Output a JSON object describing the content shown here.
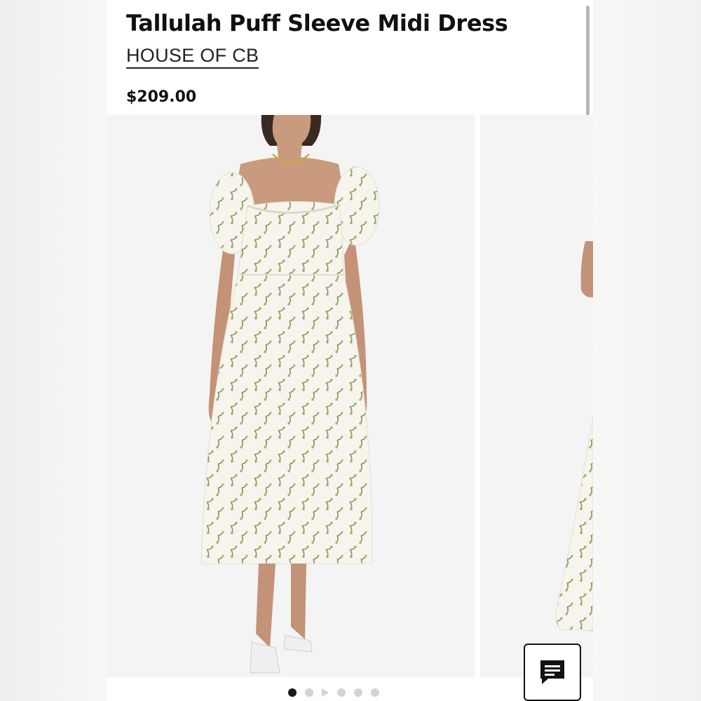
{
  "product": {
    "title": "Tallulah Puff Sleeve Midi Dress",
    "brand": "HOUSE OF CB",
    "price": "$209.00"
  },
  "gallery": {
    "slides": [
      {
        "icon": "model-wearing-floral-midi-dress-front-image"
      },
      {
        "icon": "model-wearing-floral-midi-dress-side-image"
      }
    ],
    "pagination": {
      "active_index": 0,
      "indicators": [
        "dot",
        "dot",
        "play",
        "dot",
        "dot",
        "dot"
      ]
    }
  },
  "chat": {
    "icon": "chat-message-icon"
  },
  "colors": {
    "text": "#111111",
    "image_background": "#f4f4f4",
    "dress_print": "#8a9a5b",
    "dot_inactive": "#cfd4dc",
    "dot_active": "#1a1a1a"
  }
}
